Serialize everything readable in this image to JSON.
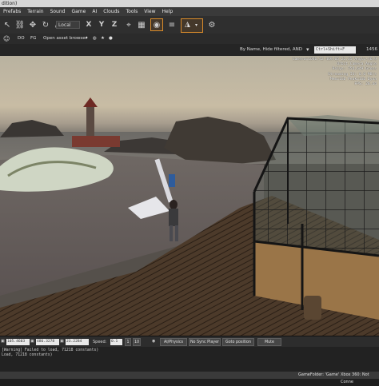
{
  "window": {
    "title": "dition)"
  },
  "menu": [
    "Prefabs",
    "Terrain",
    "Sound",
    "Game",
    "AI",
    "Clouds",
    "Tools",
    "View",
    "Help"
  ],
  "toolbar": {
    "coord_system": "Local",
    "axis_x": "X",
    "axis_y": "Y",
    "axis_z": "Z"
  },
  "toolbar2": {
    "label_do": "DO",
    "label_fg": "FG",
    "asset_browser": "Open asset browser"
  },
  "viewport": {
    "filter_text": "By Name, Hide filtered, AND",
    "search_placeholder": "Ctrl+Shift+F",
    "corner_value": "1456",
    "stats": [
      "Camera=1046.42 469.05 21.35 Angl=-76.9",
      "Orbit Camera Angle",
      "Polys: 754,649 Gross",
      "Streaming IO: 0.0 MB/s",
      "Mem=1Gb Peak=1Gb Dyna",
      "FPS: 28.44"
    ]
  },
  "statusbar": {
    "x_value": "105.4603",
    "y_value": "486.3278",
    "z_value": "23.2284",
    "speed_label": "Speed:",
    "speed_value": "0.1",
    "speed_presets": [
      "1",
      "10"
    ],
    "buttons": [
      "AI/Physics",
      "No Sync Player",
      "Goto position",
      "Mute"
    ]
  },
  "console": {
    "lines": [
      "[Warning] Failed to load, 71218 constants)",
      "Load, 71218 constants)"
    ]
  },
  "bottombar": {
    "game_folder": "GameFolder: 'Game'",
    "xbox_status": "Xbox 360: Not Conne"
  }
}
